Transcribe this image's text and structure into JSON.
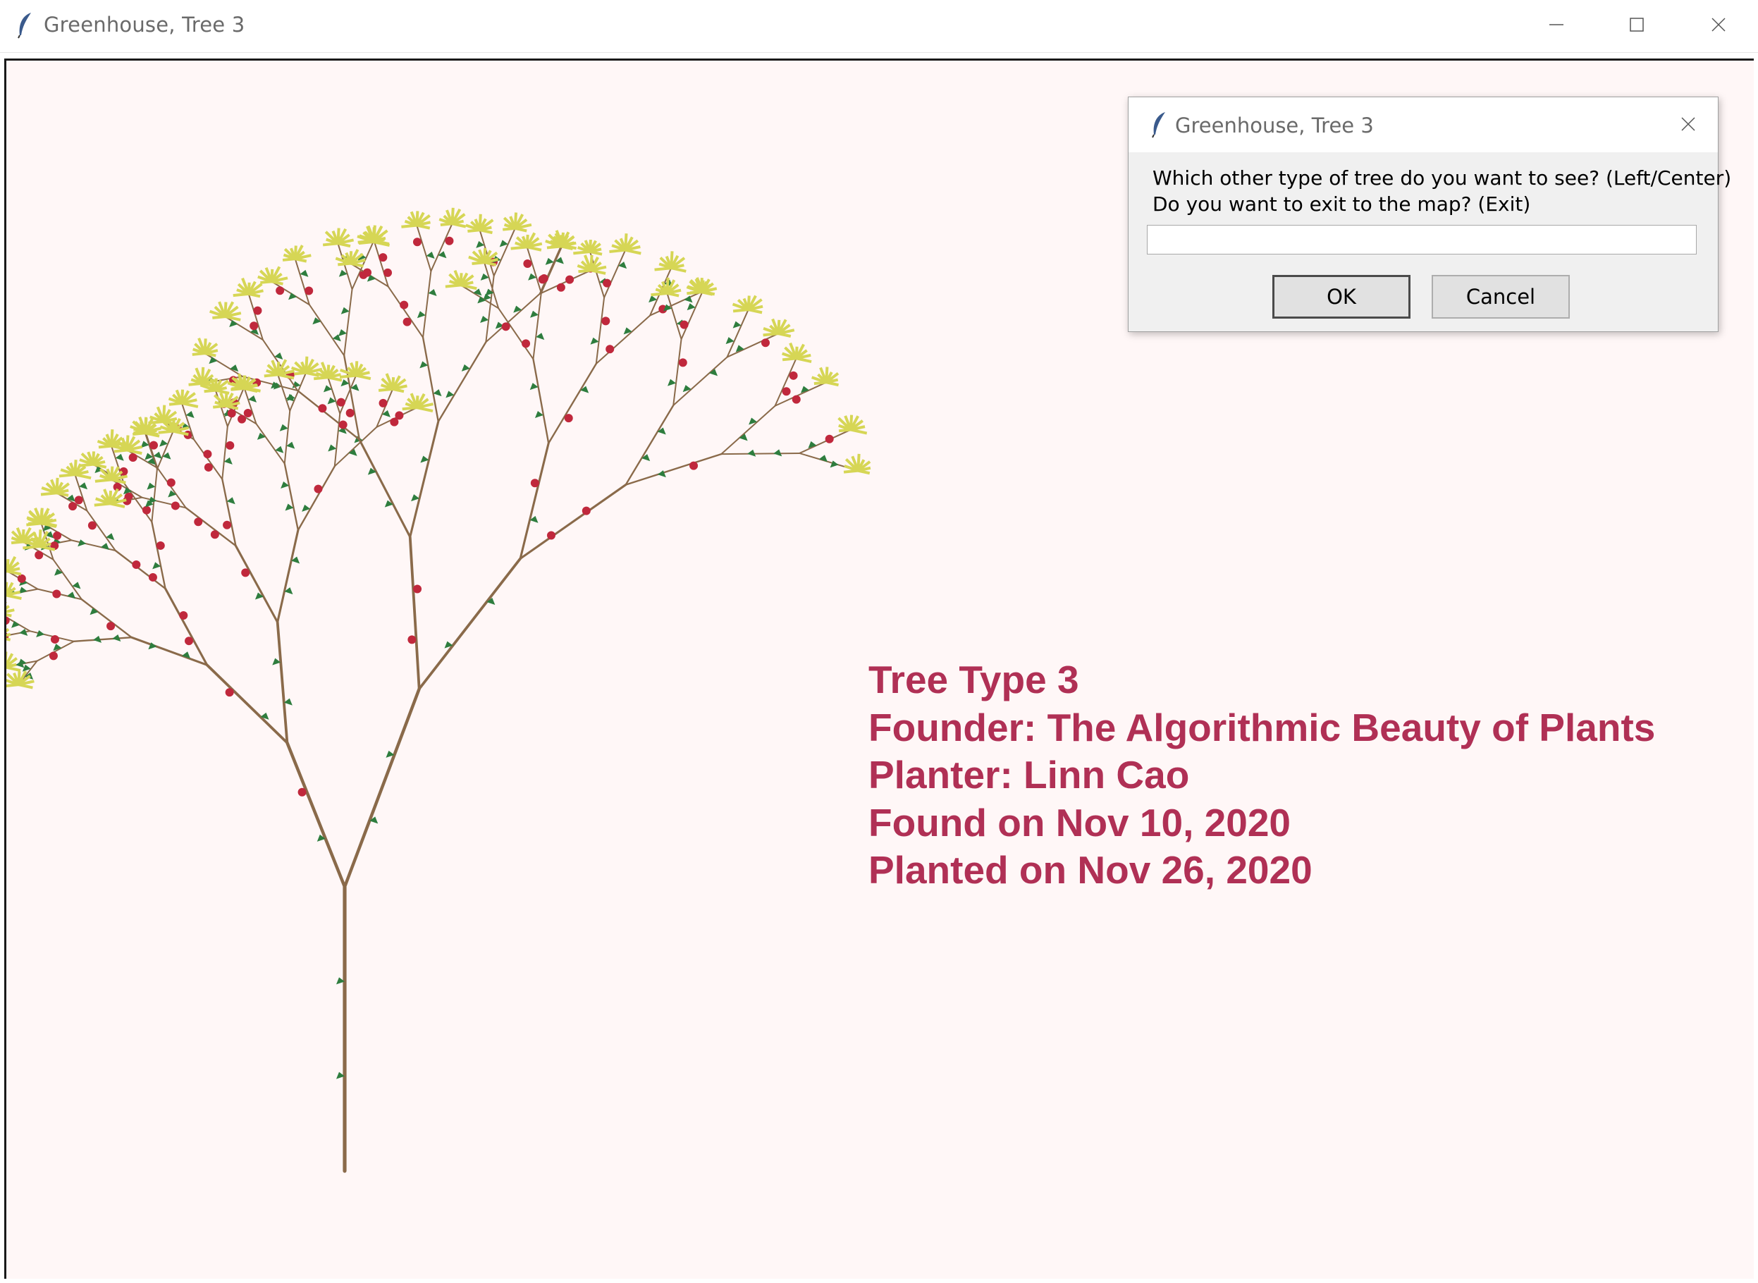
{
  "window": {
    "title": "Greenhouse, Tree 3",
    "icon": "feather-icon",
    "controls": [
      "minimize-icon",
      "maximize-icon",
      "close-icon"
    ]
  },
  "canvas": {
    "background": "#fff7f7",
    "info_lines": [
      "Tree Type 3",
      "Founder: The Algorithmic Beauty of Plants",
      "Planter: Linn Cao",
      "Found on Nov 10, 2020",
      "Planted on Nov 26, 2020"
    ],
    "info_color": "#b03055",
    "tree_colors": {
      "branch": "#8a6a4a",
      "leaf": "#2e7d3e",
      "berry": "#c0283c",
      "flower": "#d6d655"
    }
  },
  "dialog": {
    "title": "Greenhouse, Tree 3",
    "prompt_line1": "Which other type of tree do you want to see? (Left/Center)",
    "prompt_line2": "Do you want to exit to the map? (Exit)",
    "input_value": "",
    "ok_label": "OK",
    "cancel_label": "Cancel"
  }
}
